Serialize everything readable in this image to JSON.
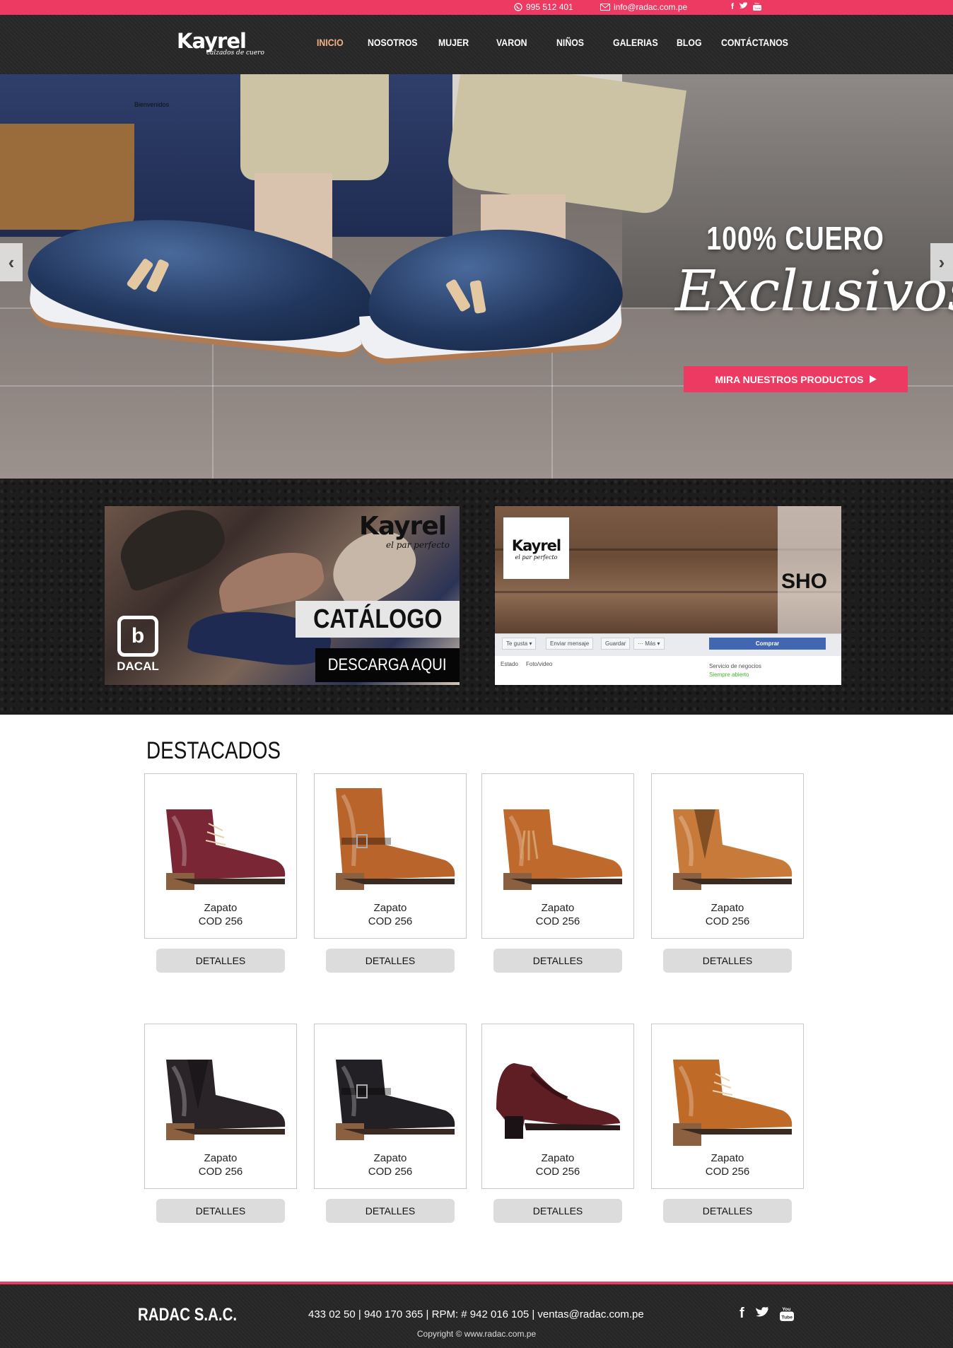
{
  "topbar": {
    "phone": "995 512 401",
    "email": "info@radac.com.pe",
    "social": [
      "f",
      "t",
      "yt"
    ],
    "accent": "#ec3a62"
  },
  "header": {
    "logo_name": "Kayrel",
    "logo_tagline": "calzados de cuero",
    "nav": [
      "INICIO",
      "NOSOTROS",
      "MUJER",
      "VARON",
      "NIÑOS",
      "GALERIAS",
      "BLOG",
      "CONTÁCTANOS"
    ],
    "active_nav": "INICIO"
  },
  "hero": {
    "tiny_text": "Bienvenidos",
    "headline": "100% CUERO",
    "script": "Exclusivos",
    "cta": "MIRA NUESTROS PRODUCTOS",
    "prev": "‹",
    "next": "›"
  },
  "banners": {
    "catalog": {
      "brand": "Kayrel",
      "tagline": "el par perfecto",
      "title": "CATÁLOGO",
      "download": "DESCARGA AQUI",
      "partner": "DACAL"
    },
    "facebook": {
      "brand": "Kayrel",
      "tagline": "el par perfecto",
      "partial_text": "SHO",
      "buttons": [
        "Te gusta ▾",
        "Enviar mensaje",
        "Guardar",
        "··· Más ▾"
      ],
      "buy": "Comprar",
      "status_tabs": [
        "Estado",
        "Foto/video"
      ],
      "business": "Servicio de negocios",
      "open": "Siempre abierto"
    }
  },
  "featured": {
    "title": "DESTACADOS",
    "button_label": "DETALLES",
    "products": [
      {
        "name": "Zapato",
        "code": "COD 256",
        "color": "#7a2634",
        "style": "lace-ankle"
      },
      {
        "name": "Zapato",
        "code": "COD 256",
        "color": "#b9642a",
        "style": "buckle-boot"
      },
      {
        "name": "Zapato",
        "code": "COD 256",
        "color": "#c0692c",
        "style": "tassel-ankle"
      },
      {
        "name": "Zapato",
        "code": "COD 256",
        "color": "#c87a3a",
        "style": "chelsea"
      },
      {
        "name": "Zapato",
        "code": "COD 256",
        "color": "#2a2428",
        "style": "chelsea"
      },
      {
        "name": "Zapato",
        "code": "COD 256",
        "color": "#222024",
        "style": "buckle-ankle"
      },
      {
        "name": "Zapato",
        "code": "COD 256",
        "color": "#5e1e24",
        "style": "pump"
      },
      {
        "name": "Zapato",
        "code": "COD 256",
        "color": "#c06a28",
        "style": "lace-heel"
      }
    ]
  },
  "footer": {
    "company": "RADAC S.A.C.",
    "contact": "433 02 50  |  940 170 365  |  RPM: # 942 016 105  | ventas@radac.com.pe",
    "copyright": "Copyright © www.radac.com.pe",
    "social": [
      "f",
      "t",
      "yt"
    ]
  }
}
